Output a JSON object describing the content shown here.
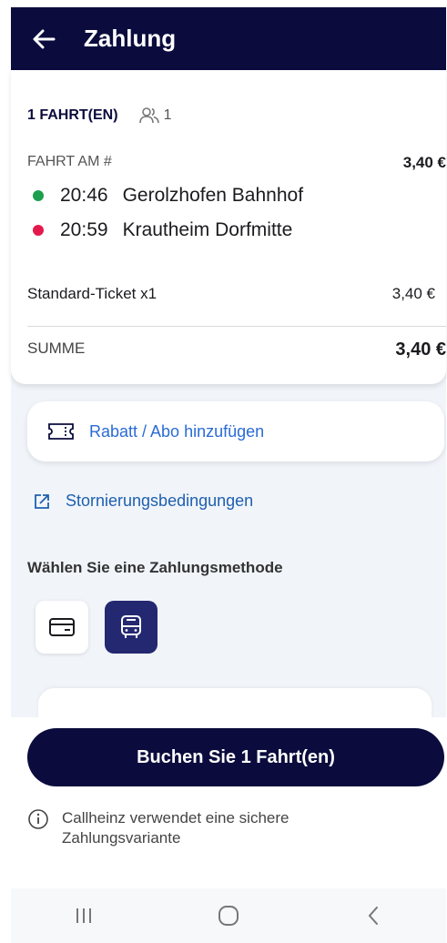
{
  "header": {
    "title": "Zahlung"
  },
  "summary": {
    "trip_count_label": "1 FAHRT(EN)",
    "passengers": "1",
    "ride_label": "FAHRT AM #",
    "ride_price": "3,40 €",
    "stops": [
      {
        "time": "20:46",
        "name": "Gerolzhofen Bahnhof",
        "color": "#1e9e4f"
      },
      {
        "time": "20:59",
        "name": "Krautheim Dorfmitte",
        "color": "#e4194b"
      }
    ],
    "ticket_label": "Standard-Ticket x1",
    "ticket_price": "3,40 €",
    "sum_label": "SUMME",
    "sum_value": "3,40 €"
  },
  "discount": {
    "label": "Rabatt / Abo hinzufügen"
  },
  "cancellation": {
    "label": "Stornierungsbedingungen"
  },
  "payment": {
    "title": "Wählen Sie eine Zahlungsmethode",
    "methods": [
      {
        "icon": "credit-card-icon",
        "selected": false
      },
      {
        "icon": "bus-icon",
        "selected": true
      }
    ]
  },
  "booking": {
    "button_label": "Buchen Sie 1 Fahrt(en)",
    "secure_note": "Callheinz verwendet eine sichere Zahlungsvariante"
  },
  "colors": {
    "primary": "#0b0c3d",
    "link": "#2a6bd4",
    "selected_method": "#242870",
    "background": "#f1f5fa"
  }
}
